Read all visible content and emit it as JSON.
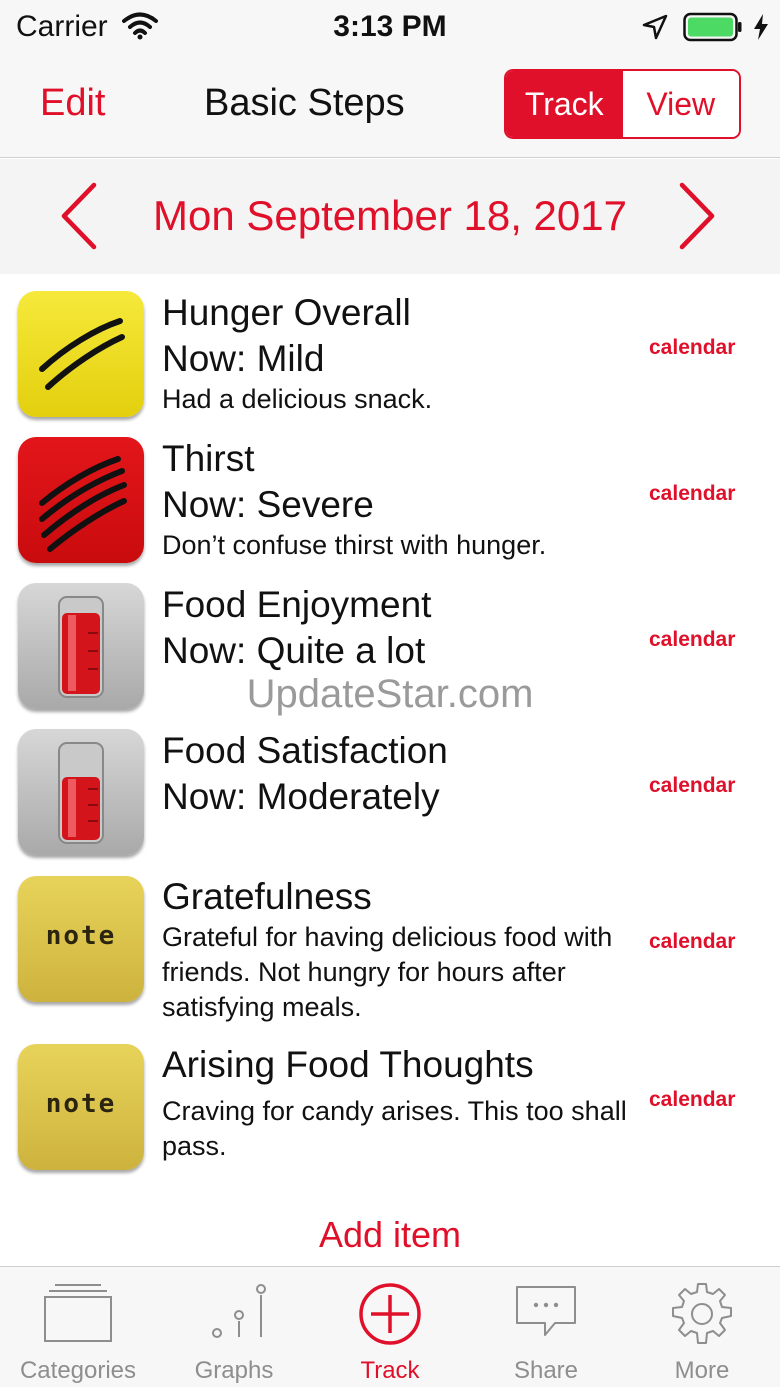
{
  "status_bar": {
    "carrier": "Carrier",
    "time": "3:13 PM"
  },
  "nav": {
    "edit_label": "Edit",
    "title": "Basic Steps",
    "segment_track": "Track",
    "segment_view": "View"
  },
  "date_bar": {
    "date": "Mon September 18, 2017"
  },
  "items": [
    {
      "title": "Hunger Overall",
      "now": "Now: Mild",
      "note": "Had a delicious snack.",
      "calendar": "calendar",
      "icon": "hunger-scale-icon"
    },
    {
      "title": "Thirst",
      "now": "Now: Severe",
      "note": "Don’t confuse thirst with hunger.",
      "calendar": "calendar",
      "icon": "thirst-scale-icon"
    },
    {
      "title": "Food Enjoyment",
      "now": "Now: Quite a lot",
      "note": "",
      "calendar": "calendar",
      "icon": "gauge-tube-icon"
    },
    {
      "title": "Food Satisfaction",
      "now": "Now: Moderately",
      "note": "",
      "calendar": "calendar",
      "icon": "gauge-tube-icon"
    },
    {
      "title": "Gratefulness",
      "note": "Grateful for having delicious food with friends. Not hungry for hours after satisfying meals.",
      "calendar": "calendar",
      "icon": "note-icon",
      "icon_text": "note"
    },
    {
      "title": "Arising Food Thoughts",
      "note": "Craving for candy arises. This too shall pass.",
      "calendar": "calendar",
      "icon": "note-icon",
      "icon_text": "note"
    }
  ],
  "watermark": "UpdateStar.com",
  "add_item_label": "Add item",
  "tabs": [
    {
      "label": "Categories",
      "icon": "categories-icon"
    },
    {
      "label": "Graphs",
      "icon": "graphs-icon"
    },
    {
      "label": "Track",
      "icon": "track-plus-icon"
    },
    {
      "label": "Share",
      "icon": "share-bubble-icon"
    },
    {
      "label": "More",
      "icon": "gear-icon"
    }
  ],
  "colors": {
    "accent": "#e0102a",
    "tab_inactive": "#8e8e8e",
    "bar_bg": "#f7f7f7"
  }
}
